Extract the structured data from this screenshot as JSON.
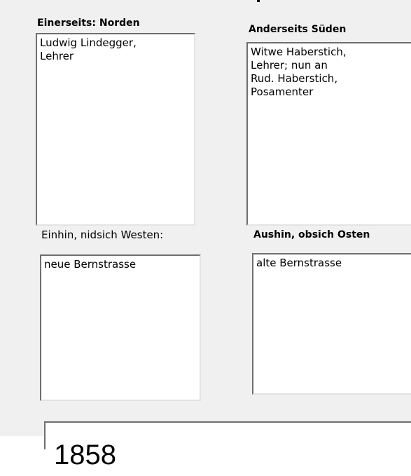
{
  "fields": {
    "north": {
      "label": "Einerseits: Norden",
      "value": "Ludwig Lindegger,\nLehrer"
    },
    "south": {
      "label": "Anderseits Süden",
      "value": "Witwe Haberstich,\nLehrer; nun an\nRud. Haberstich,\nPosamenter"
    },
    "west": {
      "label": "Einhin, nidsich Westen:",
      "value": "neue Bernstrasse"
    },
    "east": {
      "label": "Aushin,  obsich Osten",
      "value": "alte Bernstrasse"
    }
  },
  "year": "1858"
}
